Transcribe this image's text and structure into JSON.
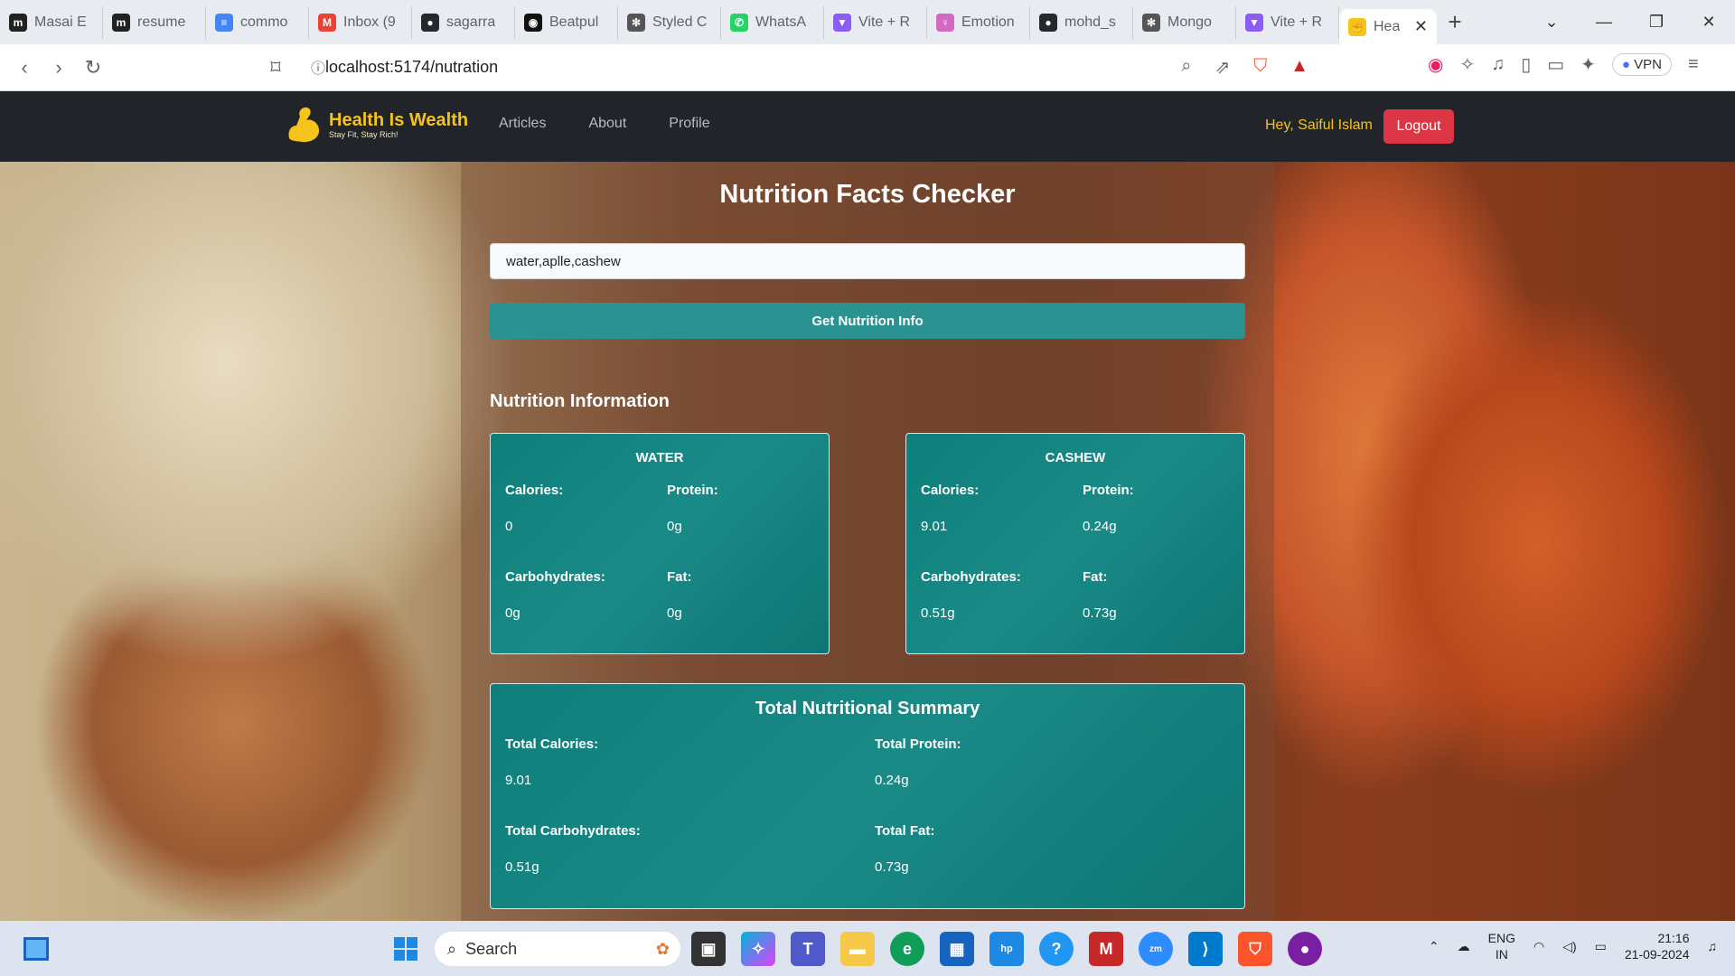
{
  "browser": {
    "tabs": [
      {
        "label": "Masai E",
        "icon": "masai-icon",
        "color": "#222222",
        "glyph": "m"
      },
      {
        "label": "resume",
        "icon": "masai-icon",
        "color": "#222222",
        "glyph": "m"
      },
      {
        "label": "commo",
        "icon": "docs-icon",
        "color": "#4285f4",
        "glyph": "≡"
      },
      {
        "label": "Inbox (9",
        "icon": "gmail-icon",
        "color": "#ea4335",
        "glyph": "M"
      },
      {
        "label": "sagarra",
        "icon": "github-icon",
        "color": "#24292e",
        "glyph": "●"
      },
      {
        "label": "Beatpul",
        "icon": "beatpulse-icon",
        "color": "#111111",
        "glyph": "◉"
      },
      {
        "label": "Styled C",
        "icon": "chatgpt-icon",
        "color": "#555555",
        "glyph": "✻"
      },
      {
        "label": "WhatsA",
        "icon": "whatsapp-icon",
        "color": "#25d366",
        "glyph": "✆"
      },
      {
        "label": "Vite + R",
        "icon": "vite-icon",
        "color": "#8b5cf6",
        "glyph": "▼"
      },
      {
        "label": "Emotion",
        "icon": "emotion-icon",
        "color": "#d36ac2",
        "glyph": "♀"
      },
      {
        "label": "mohd_s",
        "icon": "github-icon",
        "color": "#24292e",
        "glyph": "●"
      },
      {
        "label": "Mongo",
        "icon": "chatgpt-icon",
        "color": "#555555",
        "glyph": "✻"
      },
      {
        "label": "Vite + R",
        "icon": "vite-icon",
        "color": "#8b5cf6",
        "glyph": "▼"
      }
    ],
    "active_tab": {
      "label": "Hea",
      "icon": "health-logo-icon"
    },
    "url": "localhost:5174/nutration",
    "vpn_label": "VPN"
  },
  "site": {
    "brand_title": "Health Is Wealth",
    "brand_tagline": "Stay Fit, Stay Rich!",
    "nav": [
      "Articles",
      "About",
      "Profile"
    ],
    "greeting": "Hey, Saiful Islam",
    "logout_label": "Logout",
    "accent_color": "#f6c21c"
  },
  "page": {
    "title": "Nutrition Facts Checker",
    "input_value": "water,aplle,cashew",
    "button_label": "Get Nutrition Info",
    "section_title": "Nutrition Information",
    "labels": {
      "calories": "Calories:",
      "protein": "Protein:",
      "carbs": "Carbohydrates:",
      "fat": "Fat:"
    },
    "items": [
      {
        "name": "WATER",
        "calories": "0",
        "protein": "0g",
        "carbs": "0g",
        "fat": "0g"
      },
      {
        "name": "CASHEW",
        "calories": "9.01",
        "protein": "0.24g",
        "carbs": "0.51g",
        "fat": "0.73g"
      }
    ],
    "summary": {
      "title": "Total Nutritional Summary",
      "calories_label": "Total Calories:",
      "calories": "9.01",
      "protein_label": "Total Protein:",
      "protein": "0.24g",
      "carbs_label": "Total Carbohydrates:",
      "carbs": "0.51g",
      "fat_label": "Total Fat:",
      "fat": "0.73g"
    }
  },
  "taskbar": {
    "search_placeholder": "Search",
    "lang_top": "ENG",
    "lang_bottom": "IN",
    "time": "21:16",
    "date": "21-09-2024"
  }
}
